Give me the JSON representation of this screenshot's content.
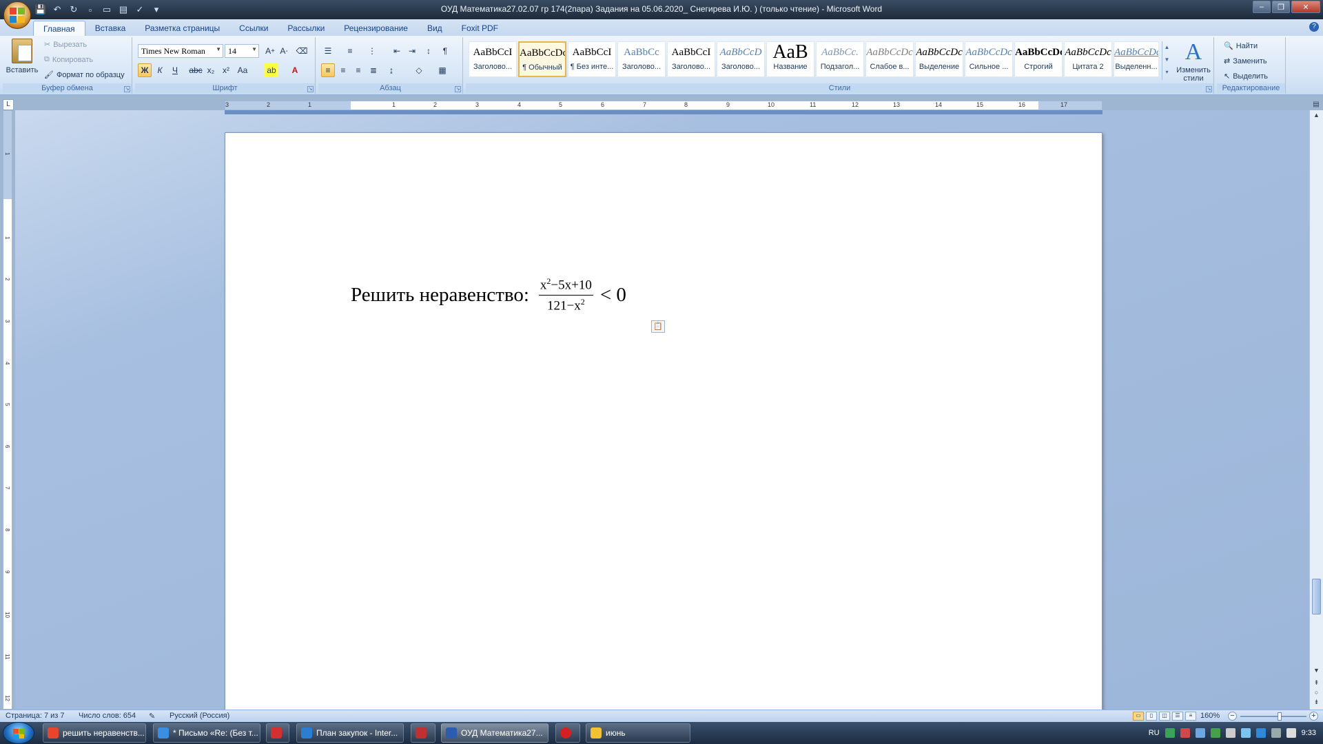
{
  "window": {
    "title": "ОУД Математика27.02.07 гр 174(2пара) Задания на 05.06.2020_ Снегирева И.Ю. ) (только чтение) - Microsoft Word"
  },
  "ribbon": {
    "tabs": [
      "Главная",
      "Вставка",
      "Разметка страницы",
      "Ссылки",
      "Рассылки",
      "Рецензирование",
      "Вид",
      "Foxit PDF"
    ],
    "active_tab": "Главная",
    "clipboard": {
      "paste": "Вставить",
      "cut": "Вырезать",
      "copy": "Копировать",
      "format_painter": "Формат по образцу",
      "label": "Буфер обмена"
    },
    "font": {
      "family": "Times New Roman",
      "size": "14",
      "label": "Шрифт"
    },
    "paragraph": {
      "label": "Абзац"
    },
    "styles": {
      "label": "Стили",
      "items": [
        {
          "sample": "AaBbCcI",
          "name": "Заголово..."
        },
        {
          "sample": "AaBbCcDc",
          "name": "¶ Обычный"
        },
        {
          "sample": "AaBbCcI",
          "name": "¶ Без инте..."
        },
        {
          "sample": "AaBbCc",
          "name": "Заголово..."
        },
        {
          "sample": "AaBbCcI",
          "name": "Заголово..."
        },
        {
          "sample": "AaBbCcD",
          "name": "Заголово..."
        },
        {
          "sample": "AaB",
          "name": "Название"
        },
        {
          "sample": "AaBbCc.",
          "name": "Подзагол..."
        },
        {
          "sample": "AaBbCcDc",
          "name": "Слабое в..."
        },
        {
          "sample": "AaBbCcDc",
          "name": "Выделение"
        },
        {
          "sample": "AaBbCcDc",
          "name": "Сильное ..."
        },
        {
          "sample": "AaBbCcDc",
          "name": "Строгий"
        },
        {
          "sample": "AaBbCcDc",
          "name": "Цитата 2"
        },
        {
          "sample": "AaBbCcDc",
          "name": "Выделенн..."
        }
      ],
      "change_styles": "Изменить стили"
    },
    "editing": {
      "label": "Редактирование",
      "find": "Найти",
      "replace": "Заменить",
      "select": "Выделить"
    }
  },
  "document": {
    "task_text": "Решить неравенство:",
    "numerator": {
      "a": "x",
      "a_exp": "2",
      "rest": "−5x+10"
    },
    "denominator": {
      "a": "121−x",
      "a_exp": "2"
    },
    "inequality": "< 0"
  },
  "ruler": {
    "h_ticks": [
      "3",
      "2",
      "1",
      "1",
      "2",
      "3",
      "4",
      "5",
      "6",
      "7",
      "8",
      "9",
      "10",
      "11",
      "12",
      "13",
      "14",
      "15",
      "16",
      "17"
    ],
    "v_ticks": [
      "1",
      "1",
      "2",
      "3",
      "4",
      "5",
      "6",
      "7",
      "8",
      "9",
      "10",
      "11",
      "12"
    ]
  },
  "statusbar": {
    "page": "Страница: 7 из 7",
    "words": "Число слов: 654",
    "language": "Русский (Россия)",
    "zoom": "160%"
  },
  "taskbar": {
    "items": [
      {
        "label": "решить неравенств...",
        "color": "#e8462c"
      },
      {
        "label": "* Письмо «Re: (Без т...",
        "color": "#3b8ee0"
      },
      {
        "label": "",
        "color": "#d62f2f"
      },
      {
        "label": "План закупок - Inter...",
        "color": "#2a7fd4"
      },
      {
        "label": "",
        "color": "#c03030"
      },
      {
        "label": "ОУД Математика27...",
        "color": "#2a5db0"
      },
      {
        "label": "",
        "color": "#d42020"
      },
      {
        "label": "июнь",
        "color": "#f2c230"
      }
    ],
    "lang": "RU",
    "time": "9:33"
  }
}
